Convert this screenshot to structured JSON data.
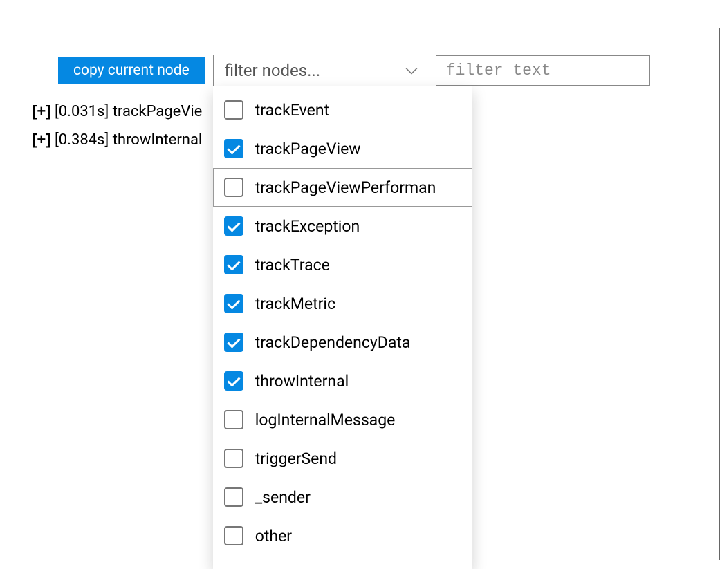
{
  "toolbar": {
    "copy_label": "copy current node",
    "filter_select_placeholder": "filter nodes...",
    "filter_text_placeholder": "filter text"
  },
  "tree": {
    "rows": [
      {
        "expander": "[+]",
        "time": "[0.031s]",
        "label": "trackPageVie"
      },
      {
        "expander": "[+]",
        "time": "[0.384s]",
        "label": "throwInternal"
      }
    ]
  },
  "dropdown": {
    "options": [
      {
        "label": "trackEvent",
        "checked": false,
        "hover": false
      },
      {
        "label": "trackPageView",
        "checked": true,
        "hover": false
      },
      {
        "label": "trackPageViewPerforman",
        "checked": false,
        "hover": true
      },
      {
        "label": "trackException",
        "checked": true,
        "hover": false
      },
      {
        "label": "trackTrace",
        "checked": true,
        "hover": false
      },
      {
        "label": "trackMetric",
        "checked": true,
        "hover": false
      },
      {
        "label": "trackDependencyData",
        "checked": true,
        "hover": false
      },
      {
        "label": "throwInternal",
        "checked": true,
        "hover": false
      },
      {
        "label": "logInternalMessage",
        "checked": false,
        "hover": false
      },
      {
        "label": "triggerSend",
        "checked": false,
        "hover": false
      },
      {
        "label": "_sender",
        "checked": false,
        "hover": false
      },
      {
        "label": "other",
        "checked": false,
        "hover": false
      }
    ]
  }
}
